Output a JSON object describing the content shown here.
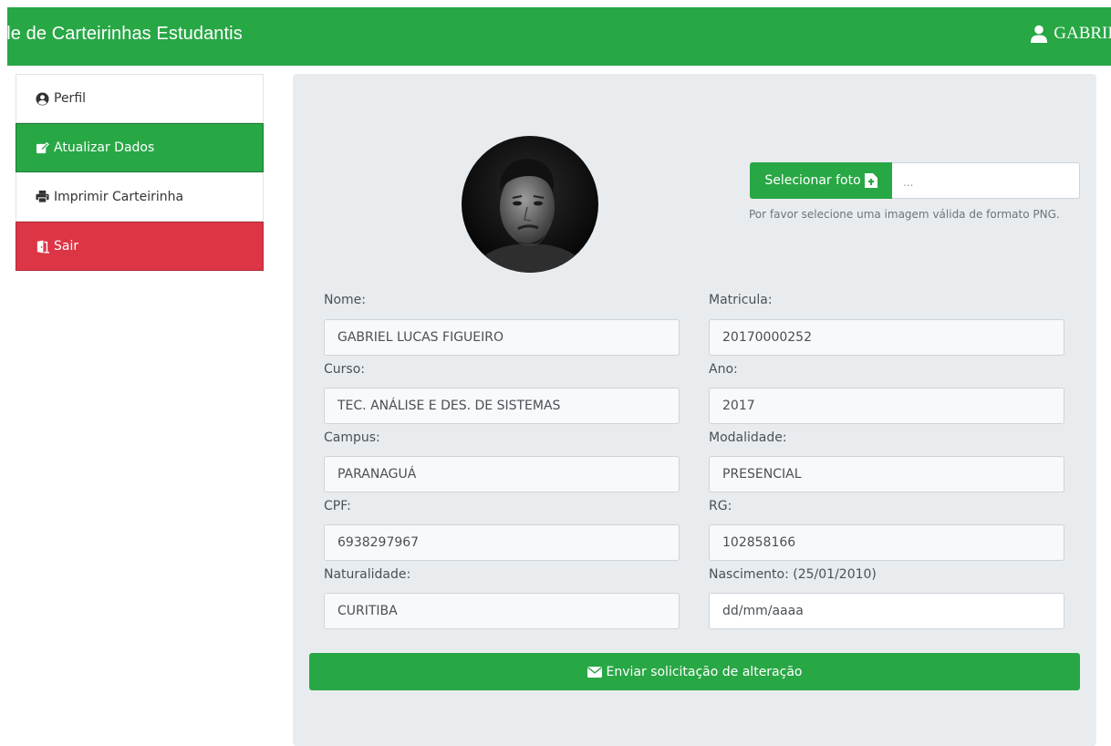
{
  "navbar": {
    "brand": "ole de Carteirinhas Estudantis",
    "user_name": "GABRIE",
    "color": "#28a745"
  },
  "sidebar": {
    "items": [
      {
        "label": "Perfil",
        "icon": "user-circle-icon"
      },
      {
        "label": "Atualizar Dados",
        "icon": "edit-icon",
        "active": true
      },
      {
        "label": "Imprimir Carteirinha",
        "icon": "print-icon"
      },
      {
        "label": "Sair",
        "icon": "door-exit-icon",
        "color": "#dc3545"
      }
    ]
  },
  "photo": {
    "button_label": "Selecionar foto",
    "file_name": "...",
    "help": "Por favor selecione uma imagem válida de formato PNG."
  },
  "form": {
    "nome": {
      "label": "Nome:",
      "value": "GABRIEL LUCAS FIGUEIRO"
    },
    "matricula": {
      "label": "Matricula:",
      "value": "20170000252"
    },
    "curso": {
      "label": "Curso:",
      "value": "TEC. ANÁLISE E DES. DE SISTEMAS"
    },
    "ano": {
      "label": "Ano:",
      "value": "2017"
    },
    "campus": {
      "label": "Campus:",
      "value": "PARANAGUÁ"
    },
    "modalidade": {
      "label": "Modalidade:",
      "value": "PRESENCIAL"
    },
    "cpf": {
      "label": "CPF:",
      "value": "6938297967"
    },
    "rg": {
      "label": "RG:",
      "value": "102858166"
    },
    "naturalidade": {
      "label": "Naturalidade:",
      "value": "CURITIBA"
    },
    "nascimento": {
      "label": "Nascimento: (25/01/2010)",
      "placeholder": "dd/mm/aaaa"
    }
  },
  "submit_label": "Enviar solicitação de alteração"
}
